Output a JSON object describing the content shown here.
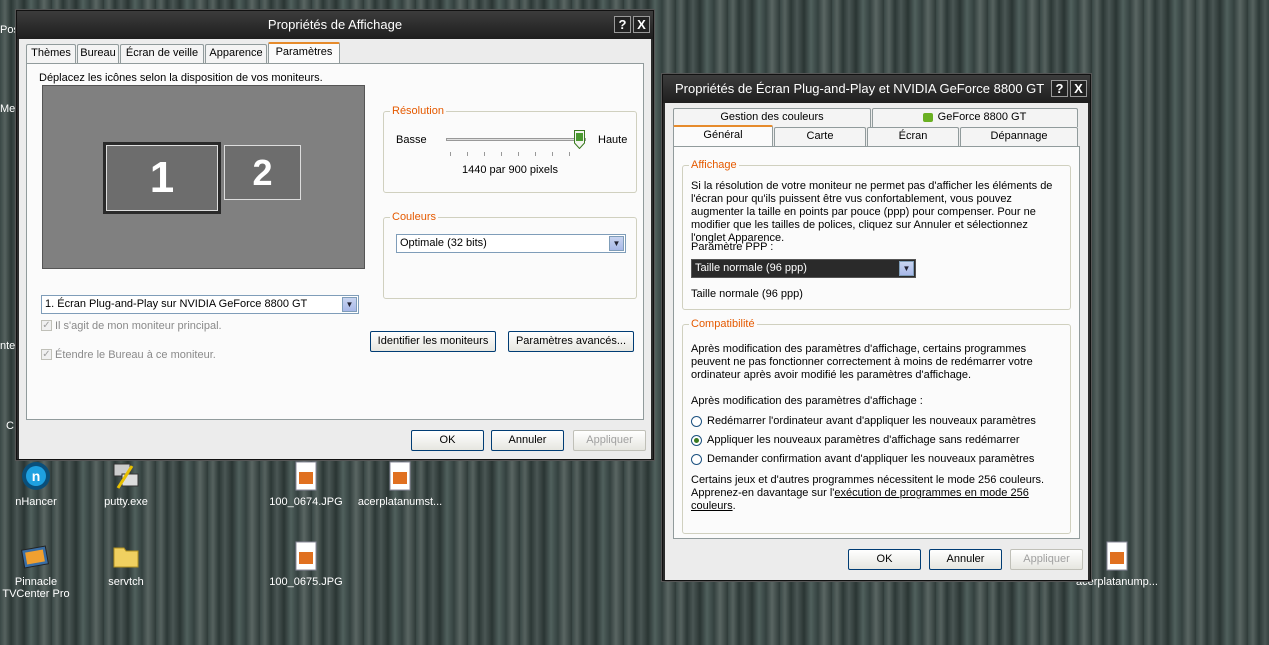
{
  "desktop": {
    "icons": [
      {
        "label": "nHancer"
      },
      {
        "label": "putty.exe"
      },
      {
        "label": "100_0674.JPG"
      },
      {
        "label": "acerplatanumst..."
      },
      {
        "label": "Pinnacle TVCenter Pro"
      },
      {
        "label": "servtch"
      },
      {
        "label": "100_0675.JPG"
      },
      {
        "label": "acerplatanump..."
      }
    ],
    "edge_labels": [
      "Pos",
      "Me",
      "nte",
      "C"
    ]
  },
  "display_props": {
    "title": "Propriétés de Affichage",
    "help_btn": "?",
    "close_btn": "X",
    "tabs": [
      "Thèmes",
      "Bureau",
      "Écran de veille",
      "Apparence",
      "Paramètres"
    ],
    "instruction": "Déplacez les icônes selon la disposition de vos moniteurs.",
    "monitor1": "1",
    "monitor2": "2",
    "resolution_label": "Résolution",
    "low": "Basse",
    "high": "Haute",
    "resolution_value": "1440 par 900 pixels",
    "resolution_level": 0.95,
    "colors_label": "Couleurs",
    "colors_value": "Optimale (32 bits)",
    "monitor_select": "1. Écran Plug-and-Play sur NVIDIA GeForce 8800 GT",
    "primary_check": "Il s'agit de mon moniteur principal.",
    "extend_check": "Étendre le Bureau à ce moniteur.",
    "identify_btn": "Identifier les moniteurs",
    "advanced_btn": "Paramètres avancés...",
    "ok": "OK",
    "cancel": "Annuler",
    "apply": "Appliquer"
  },
  "plugplay_props": {
    "title": "Propriétés de Écran Plug-and-Play et NVIDIA GeForce 8800 GT",
    "help_btn": "?",
    "close_btn": "X",
    "tabs_top": [
      "Gestion des couleurs",
      "GeForce 8800 GT"
    ],
    "tabs_bottom": [
      "Général",
      "Carte",
      "Écran",
      "Dépannage"
    ],
    "display_group": "Affichage",
    "display_text": "Si la résolution de votre moniteur ne permet pas d'afficher les éléments de l'écran pour qu'ils puissent être vus confortablement, vous pouvez augmenter la taille en points par pouce (ppp) pour compenser. Pour ne modifier que les tailles de polices, cliquez sur Annuler et sélectionnez l'onglet Apparence.",
    "dpi_label": "Paramètre PPP :",
    "dpi_value": "Taille normale (96 ppp)",
    "dpi_info": "Taille normale (96 ppp)",
    "compat_group": "Compatibilité",
    "compat_text": "Après modification des paramètres d'affichage, certains programmes peuvent ne pas fonctionner correctement à moins de redémarrer votre ordinateur après avoir modifié les paramètres d'affichage.",
    "after_label": "Après modification des paramètres d'affichage :",
    "radio1": "Redémarrer l'ordinateur avant d'appliquer les nouveaux paramètres",
    "radio2": "Appliquer les nouveaux paramètres d'affichage sans redémarrer",
    "radio3": "Demander confirmation avant d'appliquer les nouveaux paramètres",
    "footer_text_1": "Certains jeux et d'autres programmes nécessitent le mode 256 couleurs.",
    "footer_text_2": "Apprenez-en davantage sur l'",
    "footer_link": "exécution de programmes en mode 256 couleurs",
    "footer_end": ".",
    "ok": "OK",
    "cancel": "Annuler",
    "apply": "Appliquer"
  }
}
